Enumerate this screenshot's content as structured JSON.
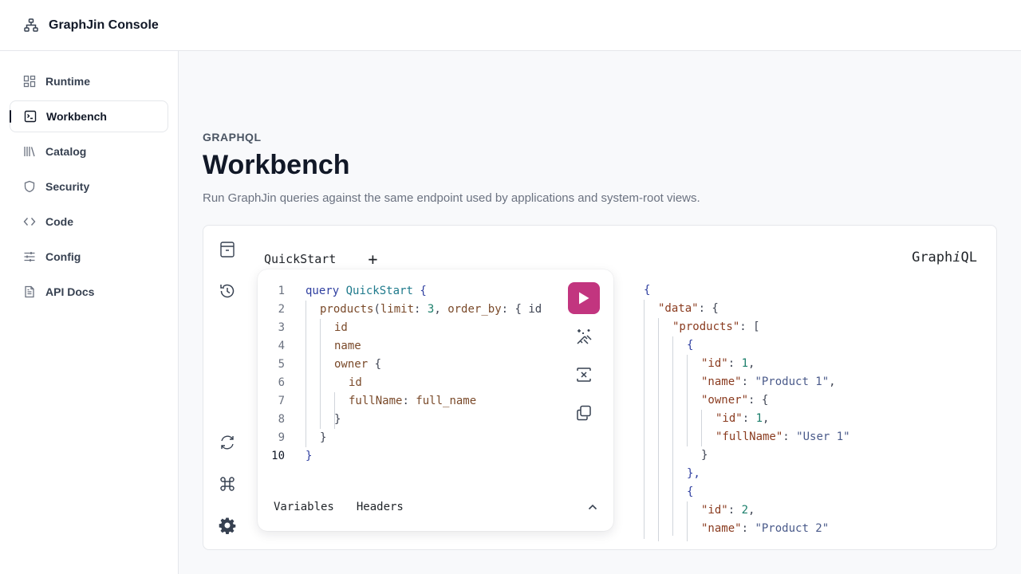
{
  "app": {
    "title": "GraphJin Console"
  },
  "sidebar": {
    "items": [
      {
        "label": "Runtime",
        "icon": "dashboard-icon",
        "active": false
      },
      {
        "label": "Workbench",
        "icon": "terminal-icon",
        "active": true
      },
      {
        "label": "Catalog",
        "icon": "library-icon",
        "active": false
      },
      {
        "label": "Security",
        "icon": "shield-icon",
        "active": false
      },
      {
        "label": "Code",
        "icon": "code-icon",
        "active": false
      },
      {
        "label": "Config",
        "icon": "sliders-icon",
        "active": false
      },
      {
        "label": "API Docs",
        "icon": "document-icon",
        "active": false
      }
    ]
  },
  "page": {
    "eyebrow": "GRAPHQL",
    "title": "Workbench",
    "subtitle": "Run GraphJin queries against the same endpoint used by applications and system-root views."
  },
  "graphiql": {
    "logo_prefix": "Graph",
    "logo_italic": "i",
    "logo_suffix": "QL",
    "tab_label": "QuickStart",
    "add_tab": "+",
    "variables_tab": "Variables",
    "headers_tab": "Headers",
    "query_lines": [
      "1",
      "2",
      "3",
      "4",
      "5",
      "6",
      "7",
      "8",
      "9",
      "10"
    ],
    "query": {
      "l1_kw": "query",
      "l1_name": "QuickStart",
      "l1_brace": "{",
      "l2_field": "products",
      "l2_args_open": "(",
      "l2_arg1": "limit",
      "l2_colon1": ": ",
      "l2_val1": "3",
      "l2_comma": ", ",
      "l2_arg2": "order_by",
      "l2_rest": ": { id",
      "l3": "id",
      "l4": "name",
      "l5_field": "owner",
      "l5_brace": "{",
      "l6": "id",
      "l7_alias": "fullName",
      "l7_colon": ": ",
      "l7_field": "full_name",
      "l8": "}",
      "l9": "}",
      "l10": "}"
    },
    "result": {
      "r1": "{",
      "r2_key": "\"data\"",
      "r2_rest": ": {",
      "r3_key": "\"products\"",
      "r3_rest": ": [",
      "r4": "{",
      "r5_key": "\"id\"",
      "r5_val": "1",
      "r6_key": "\"name\"",
      "r6_val": "\"Product 1\"",
      "r7_key": "\"owner\"",
      "r7_rest": ": {",
      "r8_key": "\"id\"",
      "r8_val": "1",
      "r9_key": "\"fullName\"",
      "r9_val": "\"User 1\"",
      "r10": "}",
      "r11": "},",
      "r12": "{",
      "r13_key": "\"id\"",
      "r13_val": "2",
      "r14_key": "\"name\"",
      "r14_val": "\"Product 2\""
    }
  },
  "colors": {
    "run_button": "#c2357f",
    "sidebar_bg": "#ffffff",
    "page_bg": "#f8f9fb"
  }
}
